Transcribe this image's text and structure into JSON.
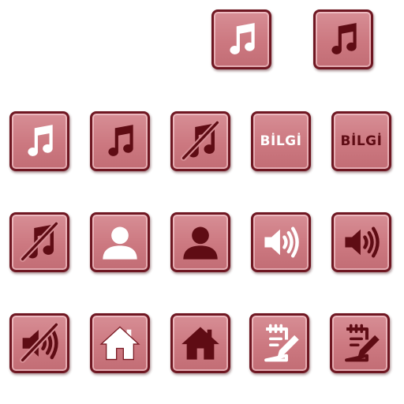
{
  "palette": {
    "tile_fill": "#cc7880",
    "tile_border": "#6f1722",
    "glyph_light": "#ffffff",
    "glyph_dark": "#5f0c14"
  },
  "icons": [
    {
      "icon": "music-note-icon",
      "variant": "light"
    },
    {
      "icon": "music-note-icon",
      "variant": "dark"
    },
    {
      "icon": "music-note-icon",
      "variant": "light"
    },
    {
      "icon": "music-note-icon",
      "variant": "dark"
    },
    {
      "icon": "music-muted-icon",
      "variant": "dark"
    },
    {
      "icon": "info-label",
      "variant": "light",
      "label": "BİLGİ"
    },
    {
      "icon": "info-label",
      "variant": "dark",
      "label": "BİLGİ"
    },
    {
      "icon": "music-muted-icon",
      "variant": "dark"
    },
    {
      "icon": "user-icon",
      "variant": "light"
    },
    {
      "icon": "user-icon",
      "variant": "dark"
    },
    {
      "icon": "speaker-icon",
      "variant": "light"
    },
    {
      "icon": "speaker-icon",
      "variant": "dark"
    },
    {
      "icon": "speaker-muted-icon",
      "variant": "dark"
    },
    {
      "icon": "home-icon",
      "variant": "light"
    },
    {
      "icon": "home-icon",
      "variant": "dark"
    },
    {
      "icon": "notepad-edit-icon",
      "variant": "light"
    },
    {
      "icon": "notepad-edit-icon",
      "variant": "dark"
    }
  ]
}
